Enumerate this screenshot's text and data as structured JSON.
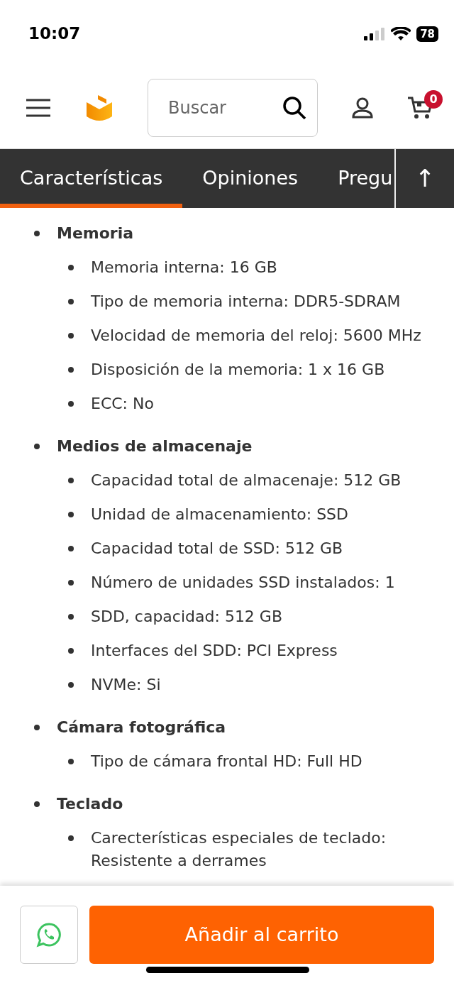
{
  "status_bar": {
    "time": "10:07",
    "battery": "78"
  },
  "header": {
    "search": {
      "placeholder": "Buscar"
    },
    "cart_count": "0"
  },
  "tabs": [
    {
      "label": "Características",
      "selected": true
    },
    {
      "label": "Opiniones",
      "selected": false
    },
    {
      "label": "Pregu",
      "selected": false
    }
  ],
  "scroll_top_button": "↑",
  "sections": [
    {
      "title": "Memoria",
      "items": [
        "Memoria interna: 16 GB",
        "Tipo de memoria interna: DDR5-SDRAM",
        "Velocidad de memoria del reloj: 5600 MHz",
        "Disposición de la memoria: 1 x 16 GB",
        "ECC: No"
      ]
    },
    {
      "title": "Medios de almacenaje",
      "items": [
        "Capacidad total de almacenaje: 512 GB",
        "Unidad de almacenamiento: SSD",
        "Capacidad total de SSD: 512 GB",
        "Número de unidades SSD instalados: 1",
        "SDD, capacidad: 512 GB",
        "Interfaces del SDD: PCI Express",
        "NVMe: Si"
      ]
    },
    {
      "title": "Cámara fotográfica",
      "items": [
        "Tipo de cámara frontal HD: Full HD"
      ]
    },
    {
      "title": "Teclado",
      "items": [
        "Carecterísticas especiales de teclado: Resistente a derrames"
      ]
    }
  ],
  "footer": {
    "add_to_cart": "Añadir al carrito"
  }
}
